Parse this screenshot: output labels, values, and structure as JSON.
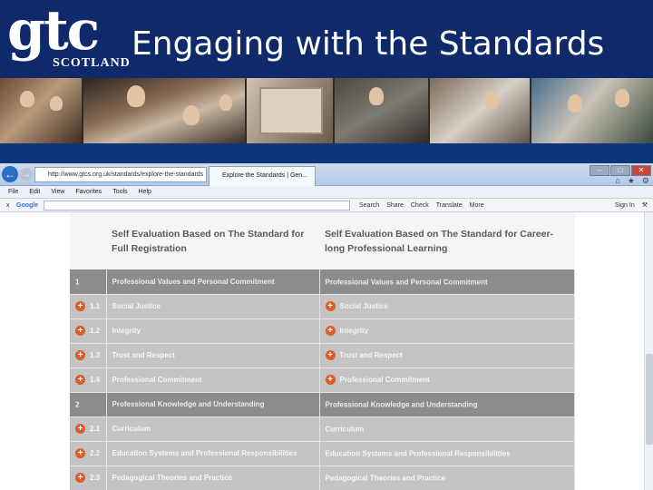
{
  "slide": {
    "title": "Engaging with the Standards",
    "logo": {
      "mark": "gtc",
      "subtitle": "SCOTLAND"
    }
  },
  "browser": {
    "address": "http://www.gtcs.org.uk/standards/explore-the-standards",
    "tab_title": "Explore the Standards | Gen...",
    "menu": [
      "File",
      "Edit",
      "View",
      "Favorites",
      "Tools",
      "Help"
    ],
    "google": {
      "close": "x",
      "logo": "Google",
      "tools": [
        "Search",
        "Share",
        "Check",
        "Translate",
        "More"
      ],
      "sign_in": "Sign In"
    }
  },
  "table": {
    "headers": {
      "col_a": "Self Evaluation Based on The Standard for Full Registration",
      "col_b": "Self Evaluation Based on The Standard for Career-long Professional Learning"
    },
    "rows": [
      {
        "num": "1",
        "a": "Professional Values and Personal Commitment",
        "b": "Professional Values and Personal Commitment",
        "section": true,
        "expand": false
      },
      {
        "num": "1.1",
        "a": "Social Justice",
        "b": "Social Justice",
        "section": false,
        "expand": true
      },
      {
        "num": "1.2",
        "a": "Integrity",
        "b": "Integrity",
        "section": false,
        "expand": true
      },
      {
        "num": "1.3",
        "a": "Trust and Respect",
        "b": "Trust and Respect",
        "section": false,
        "expand": true
      },
      {
        "num": "1.4",
        "a": "Professional Commitment",
        "b": "Professional Commitment",
        "section": false,
        "expand": true
      },
      {
        "num": "2",
        "a": "Professional Knowledge and Understanding",
        "b": "Professional Knowledge and Understanding",
        "section": true,
        "expand": false
      },
      {
        "num": "2.1",
        "a": "Curriculum",
        "b": "Curriculum",
        "section": false,
        "expand": false
      },
      {
        "num": "2.2",
        "a": "Education Systems and Professional Responsibilities",
        "b": "Education Systems and Professional Responsibilities",
        "section": false,
        "expand": false
      },
      {
        "num": "2.3",
        "a": "Pedagogical Theories and Practice",
        "b": "Pedagogical Theories and Practice",
        "section": false,
        "expand": false
      }
    ]
  },
  "colors": {
    "header_bg": "#0f2a6b",
    "expand_icon": "#e05a24",
    "section_row": "#8c8c8c",
    "item_row": "#c4c4c4"
  }
}
